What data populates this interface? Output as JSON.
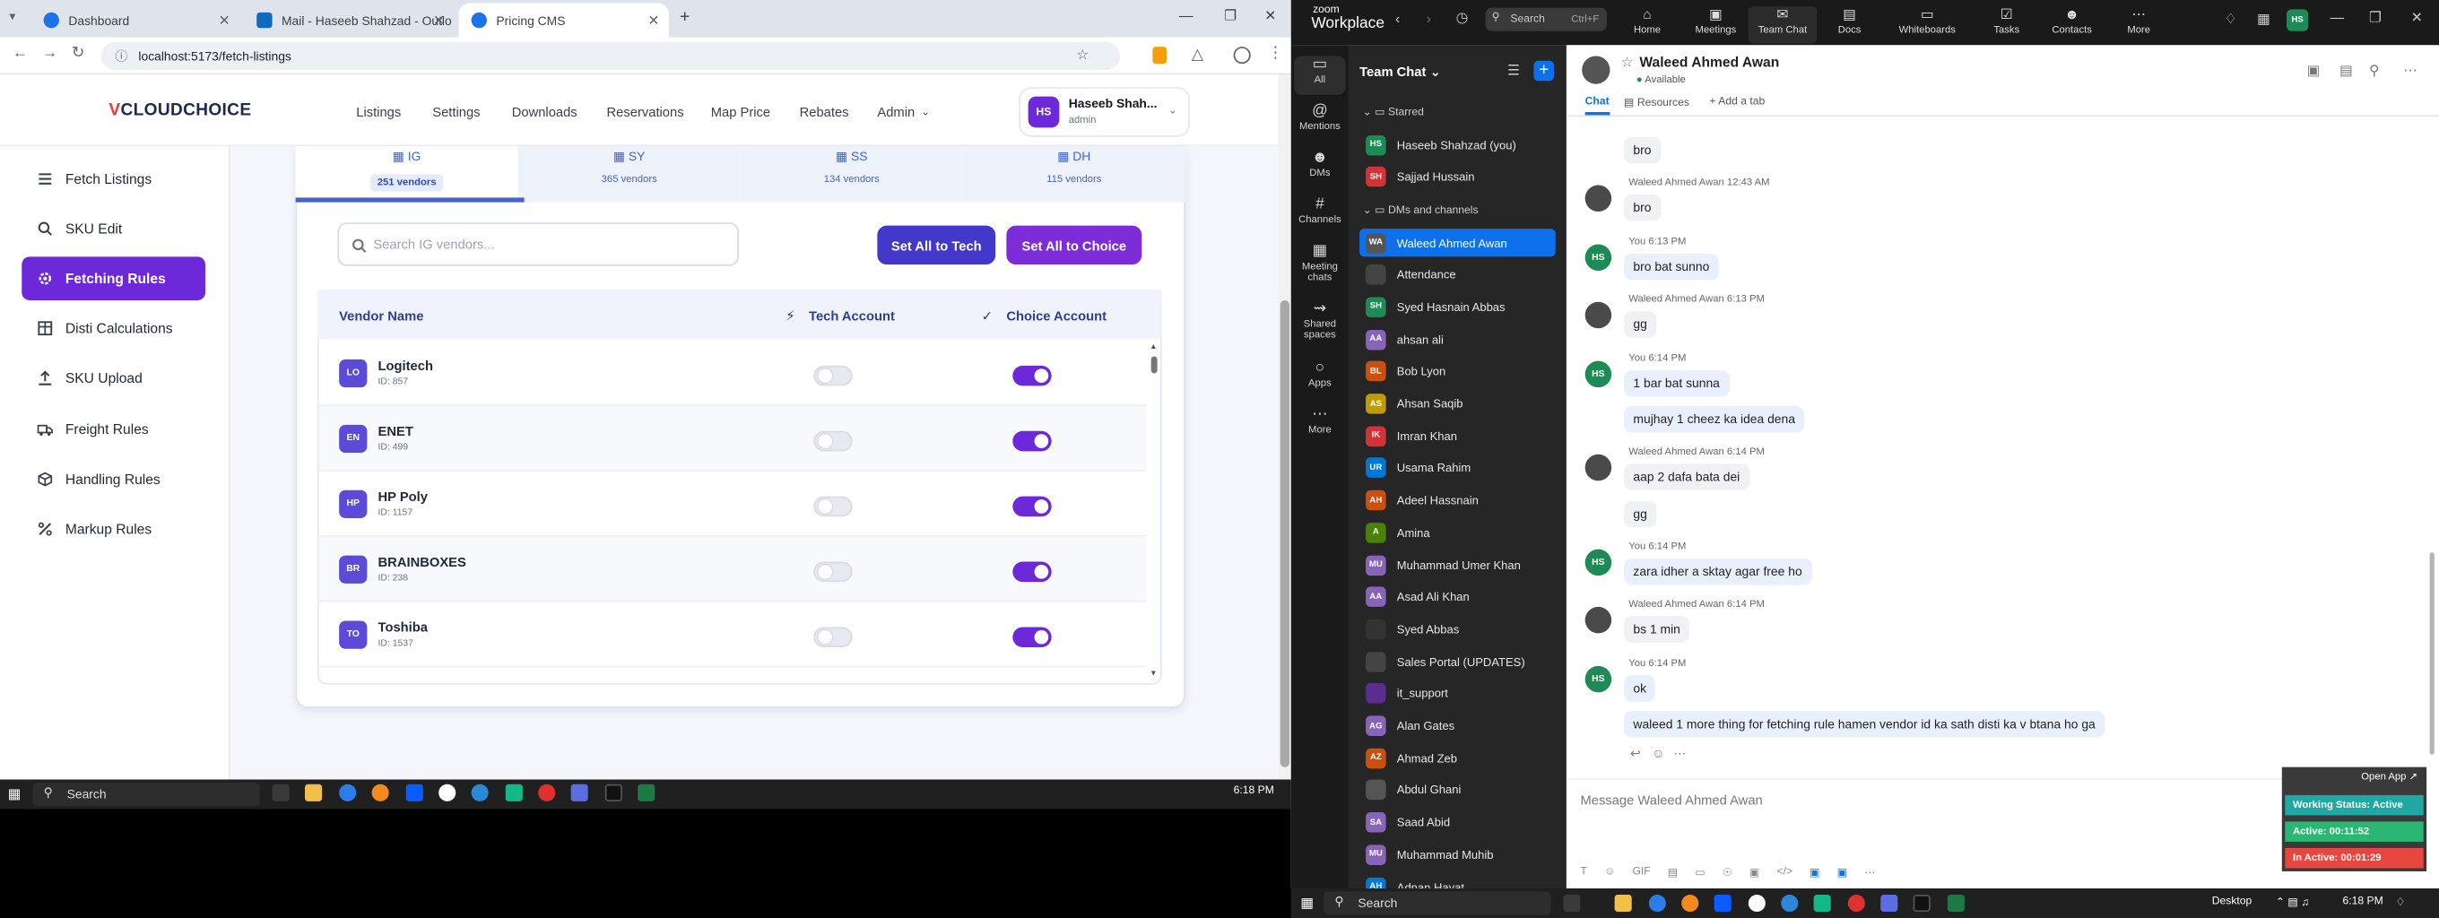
{
  "browser": {
    "tabs": [
      {
        "title": "Dashboard",
        "icon": "chrome-page-icon"
      },
      {
        "title": "Mail - Haseeb Shahzad - Outlo",
        "icon": "outlook-icon"
      },
      {
        "title": "Pricing CMS",
        "icon": "chrome-page-icon"
      }
    ],
    "url": "localhost:5173/fetch-listings"
  },
  "app": {
    "logo_v": "V",
    "logo_text": "CLOUDCHOICE",
    "nav": [
      "Listings",
      "Settings",
      "Downloads",
      "Reservations",
      "Map Price",
      "Rebates",
      "Admin"
    ],
    "user": {
      "initials": "HS",
      "name": "Haseeb Shah...",
      "role": "admin"
    },
    "sidebar": [
      {
        "label": "Fetch Listings",
        "icon": "list-icon"
      },
      {
        "label": "SKU Edit",
        "icon": "search-icon"
      },
      {
        "label": "Fetching Rules",
        "icon": "gear-icon"
      },
      {
        "label": "Disti Calculations",
        "icon": "table-icon"
      },
      {
        "label": "SKU Upload",
        "icon": "upload-icon"
      },
      {
        "label": "Freight Rules",
        "icon": "truck-icon"
      },
      {
        "label": "Handling Rules",
        "icon": "box-icon"
      },
      {
        "label": "Markup Rules",
        "icon": "percent-icon"
      }
    ],
    "vendor_tabs": [
      {
        "code": "IG",
        "count": "251 vendors"
      },
      {
        "code": "SY",
        "count": "365 vendors"
      },
      {
        "code": "SS",
        "count": "134 vendors"
      },
      {
        "code": "DH",
        "count": "115 vendors"
      }
    ],
    "search_placeholder": "Search IG vendors...",
    "set_all_tech": "Set All to Tech",
    "set_all_choice": "Set All to Choice",
    "table_headers": {
      "vendor": "Vendor Name",
      "tech": "Tech Account",
      "choice": "Choice Account"
    },
    "vendors": [
      {
        "badge": "LO",
        "name": "Logitech",
        "id": "ID: 857",
        "tech": false,
        "choice": true
      },
      {
        "badge": "EN",
        "name": "ENET",
        "id": "ID: 499",
        "tech": false,
        "choice": true
      },
      {
        "badge": "HP",
        "name": "HP Poly",
        "id": "ID: 1157",
        "tech": false,
        "choice": true
      },
      {
        "badge": "BR",
        "name": "BRAINBOXES",
        "id": "ID: 238",
        "tech": false,
        "choice": true
      },
      {
        "badge": "TO",
        "name": "Toshiba",
        "id": "ID: 1537",
        "tech": false,
        "choice": true
      }
    ]
  },
  "taskbar_left": {
    "search": "Search",
    "time": "6:18 PM"
  },
  "zoom": {
    "brand_top": "zoom",
    "brand": "Workplace",
    "search": "Search",
    "search_shortcut": "Ctrl+F",
    "top_tabs": [
      "Home",
      "Meetings",
      "Team Chat",
      "Docs",
      "Whiteboards",
      "Tasks",
      "Contacts",
      "More"
    ],
    "rail": [
      "All",
      "Mentions",
      "DMs",
      "Channels",
      "Meeting chats",
      "Shared spaces",
      "Apps",
      "More"
    ],
    "list_title": "Team Chat",
    "sections": {
      "starred": "Starred",
      "dms": "DMs and channels"
    },
    "starred": [
      {
        "name": "Haseeb Shahzad (you)",
        "initials": "HS",
        "color": "#1e8a55"
      },
      {
        "name": "Sajjad Hussain",
        "initials": "SH",
        "color": "#d13438"
      }
    ],
    "contacts": [
      {
        "name": "Waleed Ahmed Awan",
        "initials": "WA",
        "color": "#555555"
      },
      {
        "name": "Attendance",
        "initials": "",
        "color": "#444444"
      },
      {
        "name": "Syed Hasnain Abbas",
        "initials": "SH",
        "color": "#1e8a55"
      },
      {
        "name": "ahsan ali",
        "initials": "AA",
        "color": "#8764b8"
      },
      {
        "name": "Bob Lyon",
        "initials": "BL",
        "color": "#ca5010"
      },
      {
        "name": "Ahsan Saqib",
        "initials": "AS",
        "color": "#c19c00"
      },
      {
        "name": "Imran Khan",
        "initials": "IK",
        "color": "#d13438"
      },
      {
        "name": "Usama Rahim",
        "initials": "UR",
        "color": "#0078d4"
      },
      {
        "name": "Adeel Hassnain",
        "initials": "AH",
        "color": "#ca5010"
      },
      {
        "name": "Amina",
        "initials": "A",
        "color": "#498205"
      },
      {
        "name": "Muhammad Umer Khan",
        "initials": "MU",
        "color": "#8764b8"
      },
      {
        "name": "Asad Ali Khan",
        "initials": "AA",
        "color": "#8764b8"
      },
      {
        "name": "Syed Abbas",
        "initials": "",
        "color": "#333333"
      },
      {
        "name": "Sales Portal (UPDATES)",
        "initials": "",
        "color": "#444444"
      },
      {
        "name": "it_support",
        "initials": "",
        "color": "#5c2d91"
      },
      {
        "name": "Alan Gates",
        "initials": "AG",
        "color": "#8764b8"
      },
      {
        "name": "Ahmad Zeb",
        "initials": "AZ",
        "color": "#ca5010"
      },
      {
        "name": "Abdul Ghani",
        "initials": "",
        "color": "#555555"
      },
      {
        "name": "Saad Abid",
        "initials": "SA",
        "color": "#8764b8"
      },
      {
        "name": "Muhammad Muhib",
        "initials": "MU",
        "color": "#8764b8"
      },
      {
        "name": "Adnan Hayat",
        "initials": "AH",
        "color": "#0078d4"
      }
    ],
    "chat": {
      "name": "Waleed Ahmed Awan",
      "status": "Available",
      "tabs": [
        "Chat",
        "Resources",
        "+ Add a tab"
      ],
      "messages": [
        {
          "from": "w",
          "header": "",
          "text": "bro"
        },
        {
          "from": "w",
          "header": "Waleed Ahmed Awan 12:43 AM",
          "text": "bro"
        },
        {
          "from": "h",
          "header": "You 6:13 PM",
          "text": "bro bat sunno"
        },
        {
          "from": "w",
          "header": "Waleed Ahmed Awan 6:13 PM",
          "text": "gg"
        },
        {
          "from": "h",
          "header": "You 6:14 PM",
          "text": "1 bar bat sunna"
        },
        {
          "from": "h",
          "header": "",
          "text": "mujhay 1 cheez ka idea dena"
        },
        {
          "from": "w",
          "header": "Waleed Ahmed Awan 6:14 PM",
          "text": "aap 2 dafa bata dei"
        },
        {
          "from": "w",
          "header": "",
          "text": "gg"
        },
        {
          "from": "h",
          "header": "You 6:14 PM",
          "text": "zara idher a sktay agar free ho"
        },
        {
          "from": "w",
          "header": "Waleed Ahmed Awan 6:14 PM",
          "text": "bs 1 min"
        },
        {
          "from": "h",
          "header": "You 6:14 PM",
          "text": "ok"
        },
        {
          "from": "h",
          "header": "",
          "text": "waleed 1 more thing for fetching rule hamen vendor id ka sath disti ka v btana ho ga"
        }
      ],
      "compose_placeholder": "Message Waleed Ahmed Awan"
    },
    "widget": {
      "open_app": "Open App ↗",
      "status": "Working Status: Active",
      "active": "Active: 00:11:52",
      "inactive": "In Active: 00:01:29"
    }
  },
  "taskbar_right": {
    "search": "Search",
    "desktop": "Desktop",
    "time": "6:18 PM"
  }
}
